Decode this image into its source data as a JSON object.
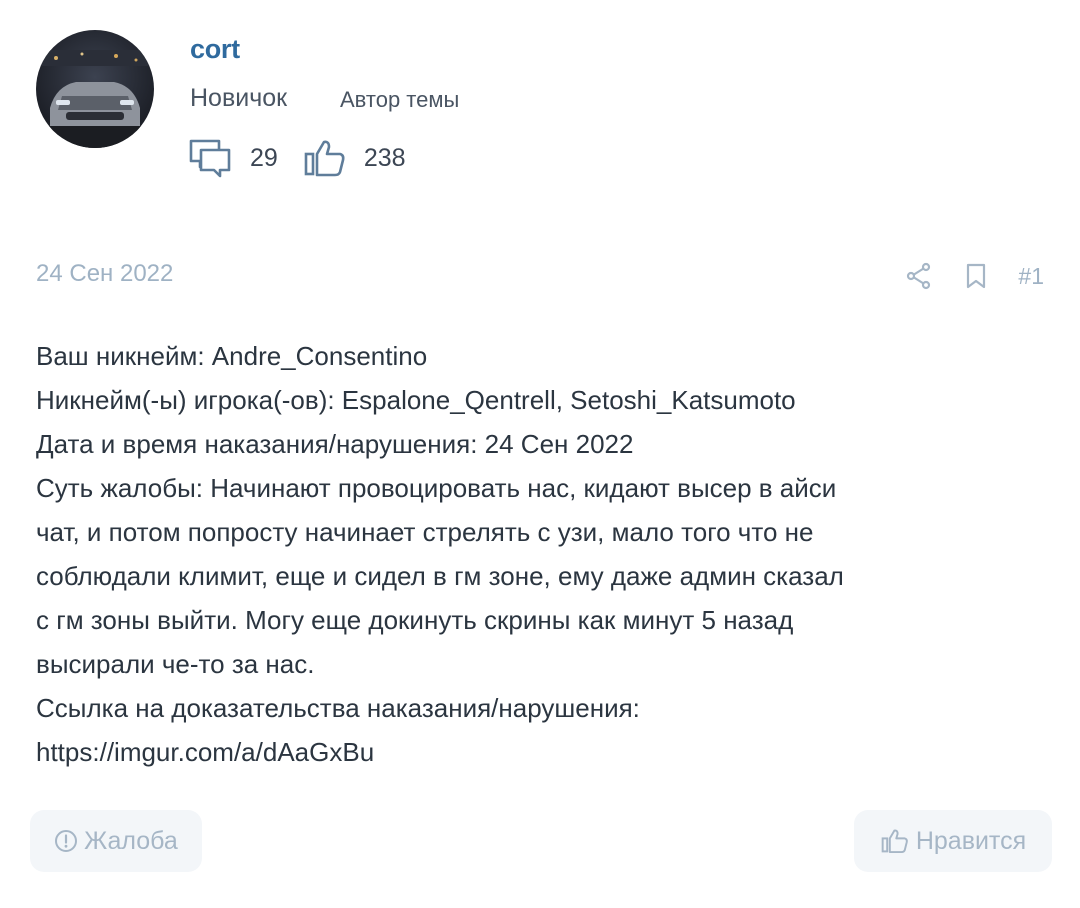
{
  "author": {
    "username": "cort",
    "rank": "Новичок",
    "badge": "Автор темы",
    "messages_icon": "comments-icon",
    "messages_count": "29",
    "likes_icon": "thumb-up-icon",
    "likes_count": "238"
  },
  "meta": {
    "date": "24 Сен 2022",
    "share_icon": "share-icon",
    "bookmark_icon": "bookmark-icon",
    "post_number": "#1"
  },
  "body": {
    "lines": [
      "Ваш никнейм: Andre_Consentino",
      "Никнейм(-ы) игрока(-ов): Espalone_Qentrell, Setoshi_Katsumoto",
      "Дата и время наказания/нарушения: 24 Сен 2022",
      "Суть жалобы: Начинают провоцировать нас, кидают высер в айси",
      "чат, и потом попросту начинает стрелять с узи, мало того что не",
      "соблюдали климит, еще и сидел в гм зоне, ему даже админ сказал",
      "с гм зоны выйти. Могу еще докинуть скрины как минут 5 назад",
      "высирали че-то за нас.",
      "Ссылка на доказательства наказания/нарушения:",
      "https://imgur.com/a/dAaGxBu"
    ]
  },
  "footer": {
    "report_icon": "exclamation-circle-icon",
    "report_label": "Жалоба",
    "like_icon": "thumb-up-icon",
    "like_label": "Нравится"
  },
  "colors": {
    "username": "#2f6a9e",
    "muted": "#9fb2c4",
    "text": "#2b3540",
    "button_bg": "#f3f6f9"
  }
}
